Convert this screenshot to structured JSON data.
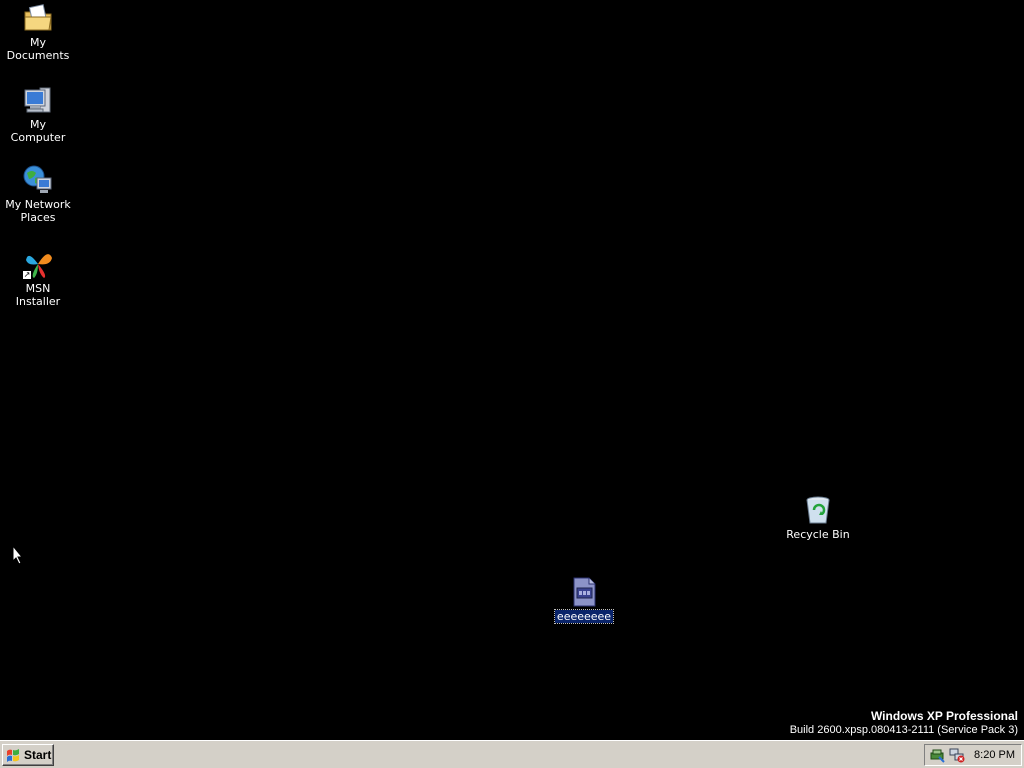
{
  "desktop": {
    "icons": [
      {
        "label": "My Documents"
      },
      {
        "label": "My Computer"
      },
      {
        "label": "My Network Places"
      },
      {
        "label": "MSN Installer"
      },
      {
        "label": "Recycle Bin"
      },
      {
        "label": "eeeeeeee"
      }
    ]
  },
  "watermark": {
    "title": "Windows XP Professional",
    "build": "Build 2600.xpsp.080413-2111 (Service Pack 3)"
  },
  "taskbar": {
    "start_label": "Start",
    "tray_icons": [
      "safely-remove-hardware-icon",
      "network-disconnected-icon"
    ],
    "clock": "8:20 PM"
  }
}
